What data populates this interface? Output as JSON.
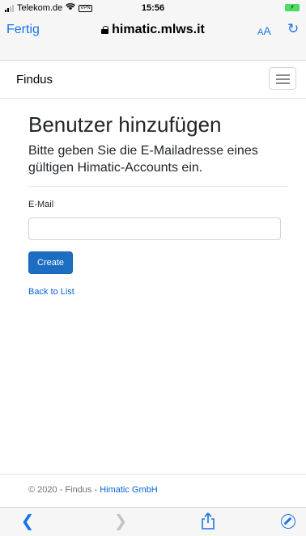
{
  "status_bar": {
    "carrier": "Telekom.de",
    "vpn_badge": "VPN",
    "time": "15:56"
  },
  "browser": {
    "done_label": "Fertig",
    "address": "himatic.mlws.it",
    "text_size_small": "A",
    "text_size_large": "A",
    "accent_color": "#1a73e8"
  },
  "site_nav": {
    "brand": "Findus"
  },
  "main": {
    "title": "Benutzer hinzufügen",
    "subtitle": "Bitte geben Sie die E-Mailadresse eines gültigen Himatic-Accounts ein.",
    "email_label": "E-Mail",
    "email_value": "",
    "create_label": "Create",
    "create_color": "#1b6ec2",
    "back_label": "Back to List"
  },
  "footer": {
    "text": "© 2020 - Findus - ",
    "link": "Himatic GmbH"
  },
  "toolbar": {
    "icons": [
      "back-icon",
      "forward-icon",
      "share-icon",
      "compass-icon"
    ]
  }
}
